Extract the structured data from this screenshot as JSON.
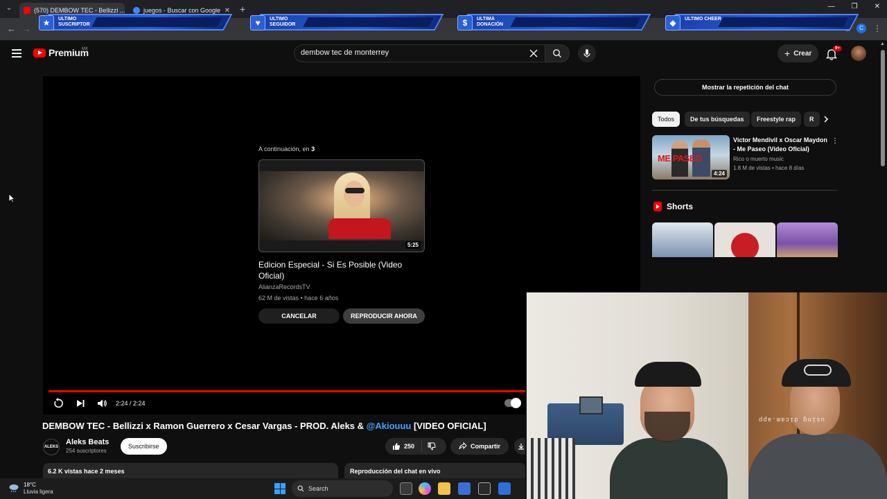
{
  "browser": {
    "tabs": [
      {
        "label": "(570) DEMBOW TEC - Bellizzi ...",
        "active": true,
        "favicon_color": "#ff0000"
      },
      {
        "label": "juegos - Buscar con Google",
        "active": false,
        "favicon_color": "#4285f4"
      }
    ],
    "new_tab": "+",
    "profile_initial": "C"
  },
  "overlay": {
    "banners": [
      {
        "label": "ULTIMO SUSCRIPTOR",
        "icon": "star-icon",
        "glyph": "★"
      },
      {
        "label": "ULTIMO SEGUIDOR",
        "icon": "heart-icon",
        "glyph": "♥"
      },
      {
        "label": "ULTIMA DONACIÓN",
        "icon": "dollar-icon",
        "glyph": "$"
      },
      {
        "label": "ULTIMO CHEER",
        "icon": "diamond-icon",
        "glyph": "◆"
      }
    ]
  },
  "header": {
    "logo_text": "Premium",
    "region": "MX",
    "search_value": "dembow tec de monterrey",
    "create_label": "Crear",
    "notification_count": "9+"
  },
  "player": {
    "upnext_prefix": "A continuación, en",
    "upnext_countdown": "3",
    "next_video": {
      "title": "Edicion Especial - Si Es Posible (Video Oficial)",
      "channel": "AlianzaRecordsTV",
      "meta": "62 M de vistas • hace 6 años",
      "duration": "5:25"
    },
    "cancel_label": "CANCELAR",
    "play_now_label": "REPRODUCIR AHORA",
    "time": "2:24 / 2:24",
    "progress": 1.0
  },
  "video": {
    "title": "DEMBOW TEC - Bellizzi x Ramon Guerrero x Cesar Vargas - PROD. Aleks & ",
    "title_mention": "@Akiouuu",
    "title_suffix": " [VIDEO OFICIAL]",
    "channel_name": "Aleks Beats",
    "channel_logo_text": "ALEKS",
    "subscribers": "254 suscriptores",
    "subscribe_label": "Suscribirse",
    "likes": "250",
    "share_label": "Compartir",
    "views_date": "6.2 K vistas  hace 2 meses",
    "chat_replay_label": "Reproducción del chat en vivo"
  },
  "sidebar": {
    "chat_toggle_label": "Mostrar la repetición del chat",
    "chips": [
      "Todos",
      "De tus búsquedas",
      "Freestyle rap",
      "R"
    ],
    "recommendation": {
      "title": "Victor Mendivil x Oscar Maydon - Me Paseo (Video Oficial)",
      "channel": "Rico o muerto music",
      "meta": "1.8 M de vistas • hace 8 días",
      "duration": "4:24",
      "thumb_text": "ME PASEO"
    },
    "shorts_label": "Shorts"
  },
  "webcam": {
    "watermark": "using dicam.app"
  },
  "taskbar": {
    "temperature": "18°C",
    "weather": "Lluvia ligera",
    "search_label": "Search"
  }
}
